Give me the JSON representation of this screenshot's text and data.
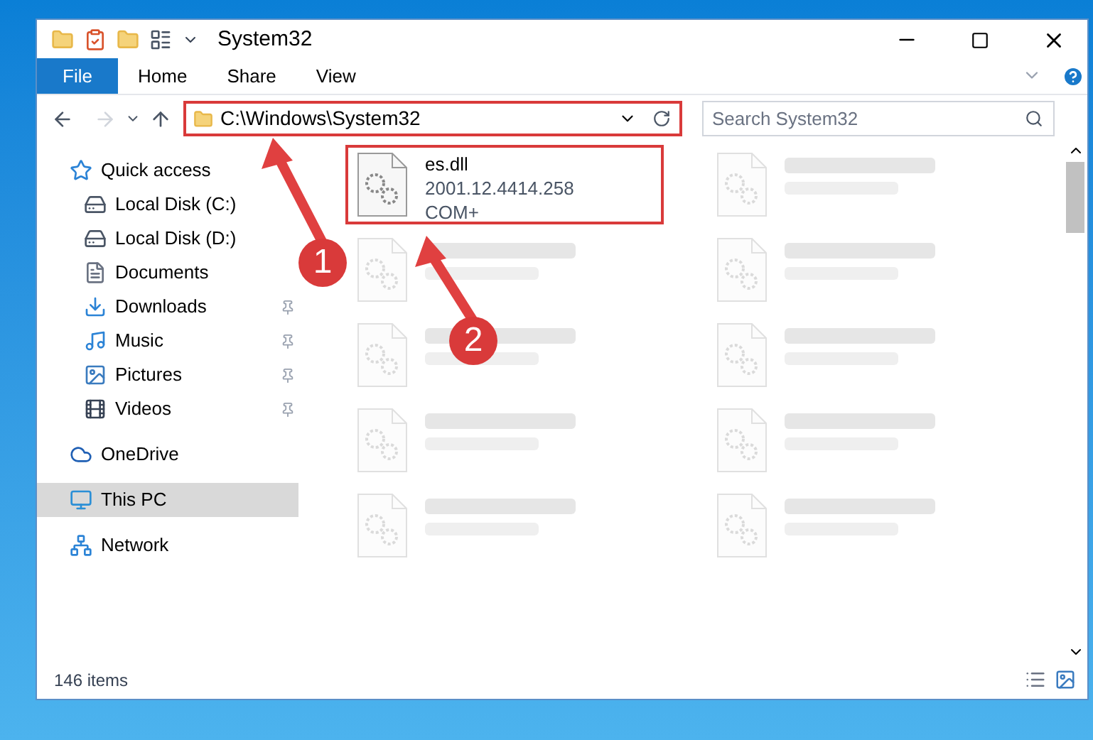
{
  "window": {
    "title": "System32"
  },
  "ribbon_tabs": [
    {
      "label": "File",
      "selected": true
    },
    {
      "label": "Home",
      "selected": false
    },
    {
      "label": "Share",
      "selected": false
    },
    {
      "label": "View",
      "selected": false
    }
  ],
  "address": {
    "path": "C:\\Windows\\System32"
  },
  "search": {
    "placeholder": "Search System32"
  },
  "sidebar": {
    "items": [
      {
        "label": "Quick access",
        "kind": "star",
        "selected": false,
        "pinned": false,
        "group": true
      },
      {
        "label": "Local Disk (C:)",
        "kind": "disk",
        "selected": false,
        "pinned": false,
        "group": false
      },
      {
        "label": "Local Disk (D:)",
        "kind": "disk",
        "selected": false,
        "pinned": false,
        "group": false
      },
      {
        "label": "Documents",
        "kind": "docs",
        "selected": false,
        "pinned": false,
        "group": false
      },
      {
        "label": "Downloads",
        "kind": "download",
        "selected": false,
        "pinned": true,
        "group": false
      },
      {
        "label": "Music",
        "kind": "music",
        "selected": false,
        "pinned": true,
        "group": false
      },
      {
        "label": "Pictures",
        "kind": "pictures",
        "selected": false,
        "pinned": true,
        "group": false
      },
      {
        "label": "Videos",
        "kind": "videos",
        "selected": false,
        "pinned": true,
        "group": false
      },
      {
        "label": "OneDrive",
        "kind": "cloud",
        "selected": false,
        "pinned": false,
        "group": true
      },
      {
        "label": "This PC",
        "kind": "pc",
        "selected": true,
        "pinned": false,
        "group": true
      },
      {
        "label": "Network",
        "kind": "network",
        "selected": false,
        "pinned": false,
        "group": true
      }
    ]
  },
  "files": [
    {
      "kind": "file",
      "name": "es.dll",
      "lines": [
        "2001.12.4414.258",
        "COM+"
      ],
      "highlighted": true
    },
    {
      "kind": "blurred"
    },
    {
      "kind": "blurred"
    },
    {
      "kind": "blurred"
    },
    {
      "kind": "blurred"
    },
    {
      "kind": "blurred"
    },
    {
      "kind": "blurred"
    },
    {
      "kind": "blurred"
    },
    {
      "kind": "blurred"
    },
    {
      "kind": "blurred"
    }
  ],
  "status_bar": {
    "count": "146 items"
  },
  "annotations": [
    {
      "number": "1"
    },
    {
      "number": "2"
    }
  ]
}
